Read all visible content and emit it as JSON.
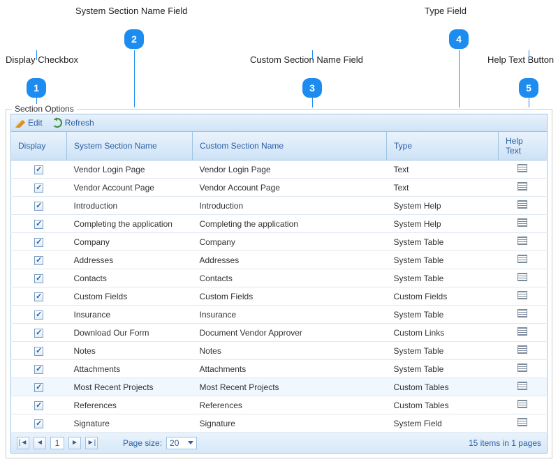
{
  "callouts": {
    "c1": {
      "label": "Display Checkbox",
      "num": "1"
    },
    "c2": {
      "label": "System Section Name Field",
      "num": "2"
    },
    "c3": {
      "label": "Custom Section Name Field",
      "num": "3"
    },
    "c4": {
      "label": "Type Field",
      "num": "4"
    },
    "c5": {
      "label": "Help Text Button",
      "num": "5"
    }
  },
  "fieldset": {
    "legend": "Section Options"
  },
  "toolbar": {
    "edit": "Edit",
    "refresh": "Refresh"
  },
  "columns": {
    "display": "Display",
    "system": "System Section Name",
    "custom": "Custom Section Name",
    "type": "Type",
    "help": "Help Text"
  },
  "rows": [
    {
      "system": "Vendor Login Page",
      "custom": "Vendor Login Page",
      "type": "Text"
    },
    {
      "system": "Vendor Account Page",
      "custom": "Vendor Account Page",
      "type": "Text"
    },
    {
      "system": "Introduction",
      "custom": "Introduction",
      "type": "System Help"
    },
    {
      "system": "Completing the application",
      "custom": "Completing the application",
      "type": "System Help"
    },
    {
      "system": "Company",
      "custom": "Company",
      "type": "System Table"
    },
    {
      "system": "Addresses",
      "custom": "Addresses",
      "type": "System Table"
    },
    {
      "system": "Contacts",
      "custom": "Contacts",
      "type": "System Table"
    },
    {
      "system": "Custom Fields",
      "custom": "Custom Fields",
      "type": "Custom Fields"
    },
    {
      "system": "Insurance",
      "custom": "Insurance",
      "type": "System Table"
    },
    {
      "system": "Download Our Form",
      "custom": "Document Vendor Approver",
      "type": "Custom Links"
    },
    {
      "system": "Notes",
      "custom": "Notes",
      "type": "System Table"
    },
    {
      "system": "Attachments",
      "custom": "Attachments",
      "type": "System Table"
    },
    {
      "system": "Most Recent Projects",
      "custom": "Most Recent Projects",
      "type": "Custom Tables"
    },
    {
      "system": "References",
      "custom": "References",
      "type": "Custom Tables"
    },
    {
      "system": "Signature",
      "custom": "Signature",
      "type": "System Field"
    }
  ],
  "pager": {
    "first": "|◄",
    "prev": "◄",
    "current": "1",
    "next": "►",
    "last": "►|",
    "page_size_label": "Page size:",
    "page_size_value": "20",
    "summary": "15 items in 1 pages"
  }
}
